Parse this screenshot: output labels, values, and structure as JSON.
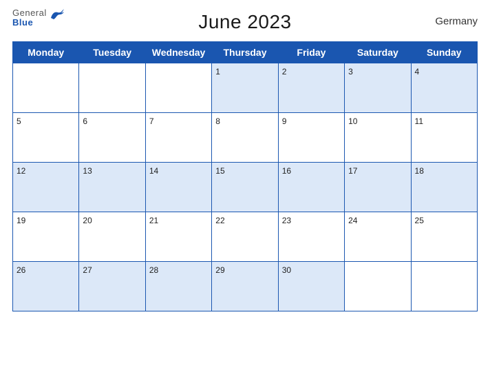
{
  "header": {
    "title": "June 2023",
    "country": "Germany",
    "logo": {
      "general": "General",
      "blue": "Blue"
    }
  },
  "days": [
    "Monday",
    "Tuesday",
    "Wednesday",
    "Thursday",
    "Friday",
    "Saturday",
    "Sunday"
  ],
  "weeks": [
    [
      null,
      null,
      null,
      1,
      2,
      3,
      4
    ],
    [
      5,
      6,
      7,
      8,
      9,
      10,
      11
    ],
    [
      12,
      13,
      14,
      15,
      16,
      17,
      18
    ],
    [
      19,
      20,
      21,
      22,
      23,
      24,
      25
    ],
    [
      26,
      27,
      28,
      29,
      30,
      null,
      null
    ]
  ]
}
